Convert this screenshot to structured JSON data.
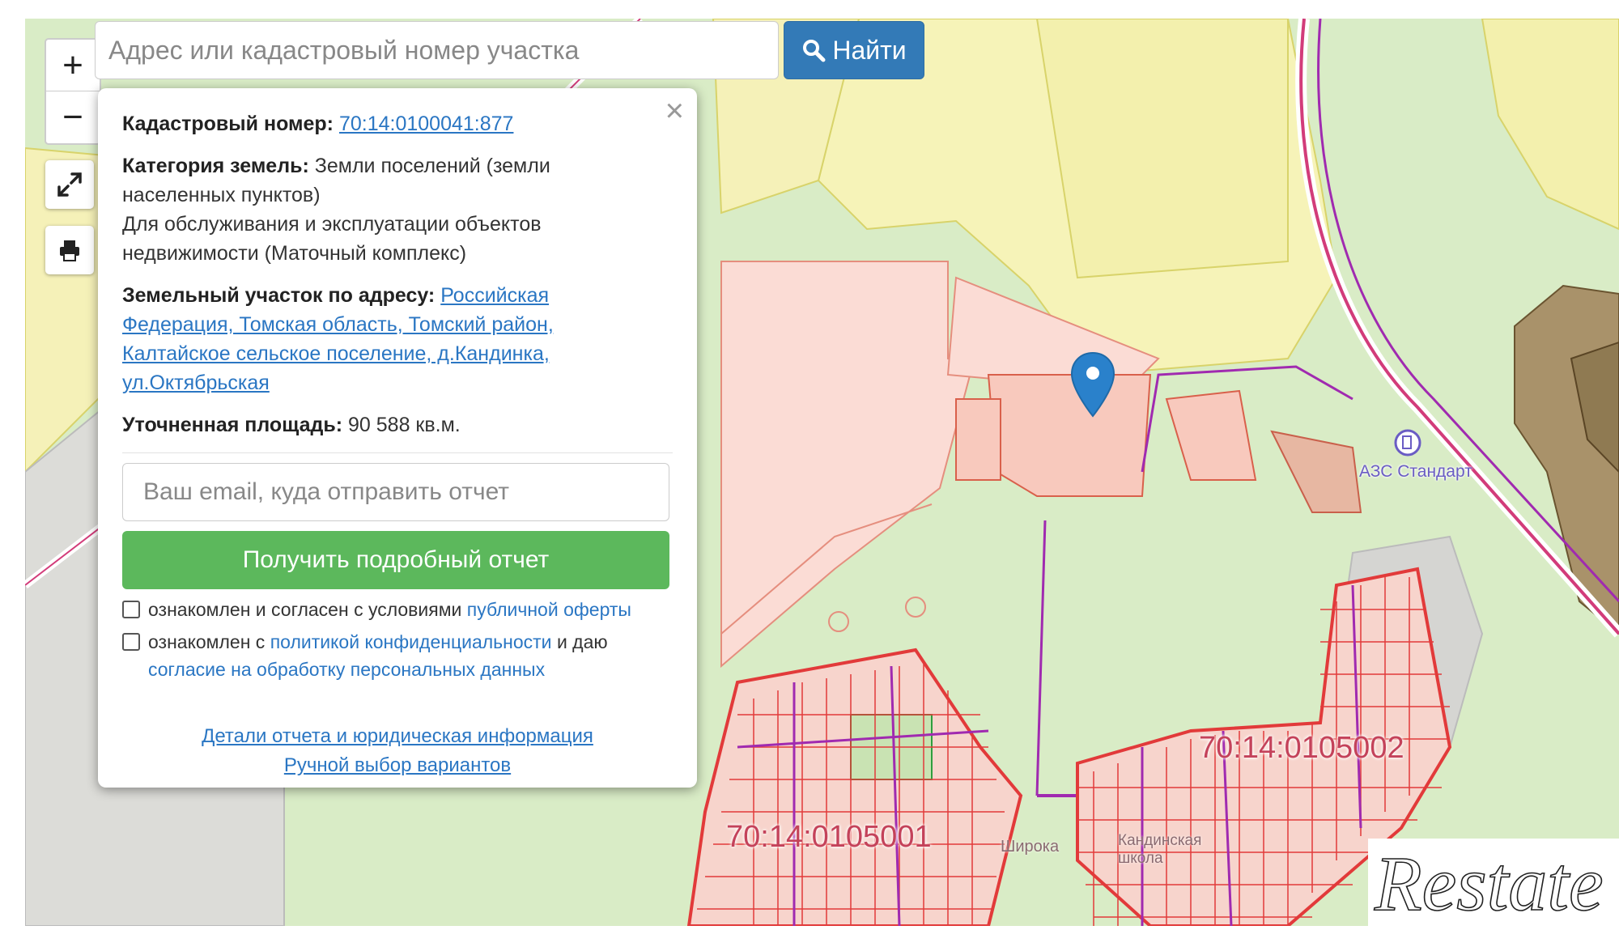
{
  "controls": {
    "zoom_in": "+",
    "zoom_out": "−",
    "fullscreen_icon": "fullscreen-icon",
    "print_icon": "print-icon"
  },
  "search": {
    "placeholder": "Адрес или кадастровый номер участка",
    "button_label": "Найти",
    "button_icon": "search-icon",
    "button_color": "#337ab7"
  },
  "popup": {
    "cadastral_label": "Кадастровый номер:",
    "cadastral_number": "70:14:0100041:877",
    "category_label": "Категория земель:",
    "category_value": "Земли поселений (земли населенных пунктов)",
    "usage": "Для обслуживания и эксплуатации объектов недвижимости (Маточный комплекс)",
    "address_label": "Земельный участок по адресу:",
    "address_value": "Российская Федерация, Томская область, Томский район, Калтайское сельское поселение, д.Кандинка, ул.Октябрьская",
    "area_label": "Уточненная площадь:",
    "area_value": "90 588 кв.м.",
    "email_placeholder": "Ваш email, куда отправить отчет",
    "report_button": "Получить подробный отчет",
    "report_button_color": "#5cb85c",
    "consent1_text": "ознакомлен и согласен с условиями",
    "consent1_link": "публичной оферты",
    "consent2_text_a": "ознакомлен с",
    "consent2_link_a": "политикой конфиденциальности",
    "consent2_text_b": "и даю",
    "consent2_link_b": "согласие на обработку персональных данных",
    "link_details": "Детали отчета и юридическая информация",
    "link_manual": "Ручной выбор вариантов"
  },
  "map": {
    "label_block1": "70:14:0105002",
    "label_block2": "70:14:0105001",
    "poi_gas_station": "АЗС Стандарт",
    "poi_school": "Кандинская школа",
    "poi_street": "Широка",
    "marker_icon": "map-marker-icon",
    "accent_parcel": "#e23a3a",
    "accent_boundary": "#a02ab0"
  },
  "watermark": {
    "text": "Restate"
  }
}
